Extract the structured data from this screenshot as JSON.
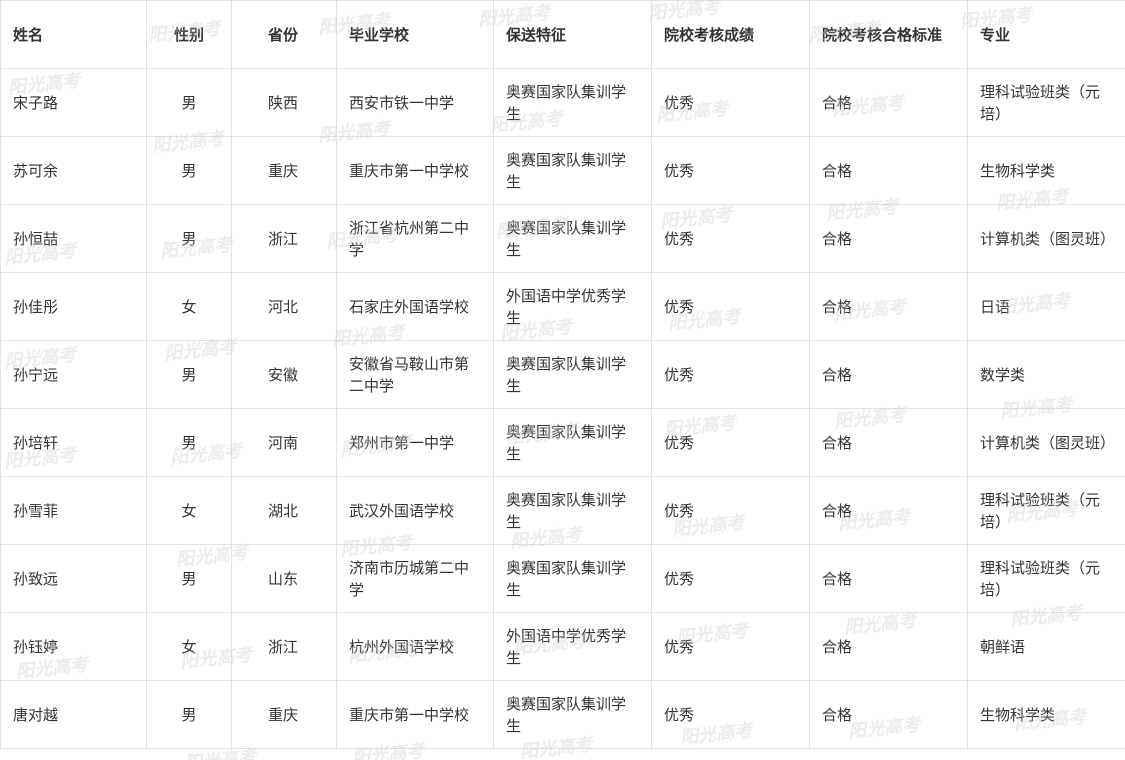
{
  "table": {
    "headers": [
      "姓名",
      "性别",
      "省份",
      "毕业学校",
      "保送特征",
      "院校考核成绩",
      "院校考核合格标准",
      "专业"
    ],
    "rows": [
      [
        "宋子路",
        "男",
        "陕西",
        "西安市铁一中学",
        "奥赛国家队集训学生",
        "优秀",
        "合格",
        "理科试验班类（元培）"
      ],
      [
        "苏可余",
        "男",
        "重庆",
        "重庆市第一中学校",
        "奥赛国家队集训学生",
        "优秀",
        "合格",
        "生物科学类"
      ],
      [
        "孙恒喆",
        "男",
        "浙江",
        "浙江省杭州第二中学",
        "奥赛国家队集训学生",
        "优秀",
        "合格",
        "计算机类（图灵班）"
      ],
      [
        "孙佳彤",
        "女",
        "河北",
        "石家庄外国语学校",
        "外国语中学优秀学生",
        "优秀",
        "合格",
        "日语"
      ],
      [
        "孙宁远",
        "男",
        "安徽",
        "安徽省马鞍山市第二中学",
        "奥赛国家队集训学生",
        "优秀",
        "合格",
        "数学类"
      ],
      [
        "孙培轩",
        "男",
        "河南",
        "郑州市第一中学",
        "奥赛国家队集训学生",
        "优秀",
        "合格",
        "计算机类（图灵班）"
      ],
      [
        "孙雪菲",
        "女",
        "湖北",
        "武汉外国语学校",
        "奥赛国家队集训学生",
        "优秀",
        "合格",
        "理科试验班类（元培）"
      ],
      [
        "孙致远",
        "男",
        "山东",
        "济南市历城第二中学",
        "奥赛国家队集训学生",
        "优秀",
        "合格",
        "理科试验班类（元培）"
      ],
      [
        "孙钰婷",
        "女",
        "浙江",
        "杭州外国语学校",
        "外国语中学优秀学生",
        "优秀",
        "合格",
        "朝鲜语"
      ],
      [
        "唐对越",
        "男",
        "重庆",
        "重庆市第一中学校",
        "奥赛国家队集训学生",
        "优秀",
        "合格",
        "生物科学类"
      ]
    ]
  },
  "watermark": {
    "text": "阳光高考",
    "color": "#c8c8c8"
  }
}
